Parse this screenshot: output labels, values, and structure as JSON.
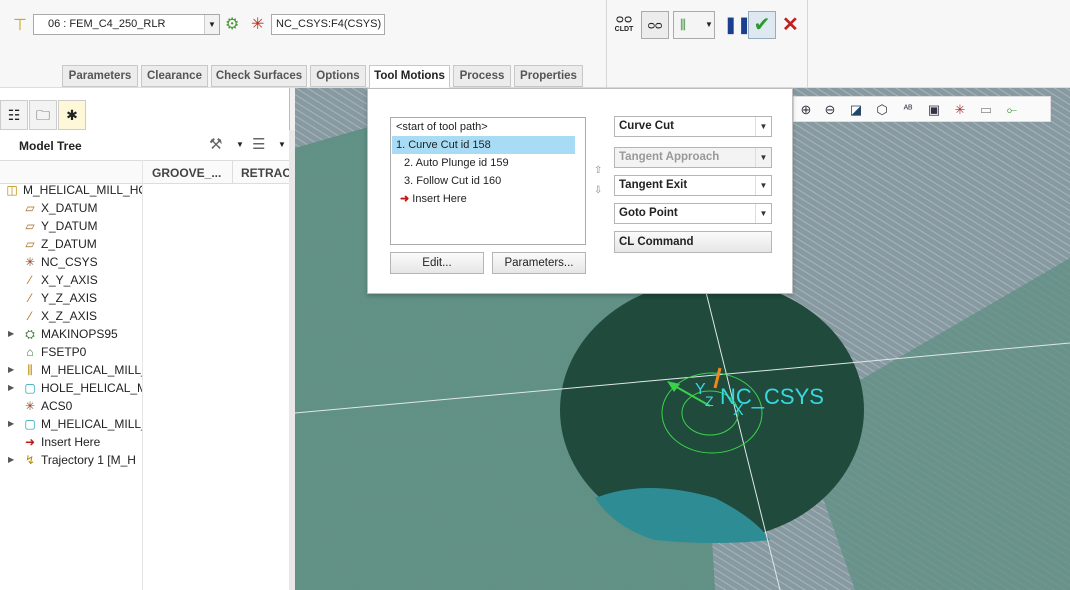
{
  "toolbar": {
    "tool_value": "06 : FEM_C4_250_RLR",
    "coord_value": "NC_CSYS:F4(CSYS) I",
    "cldt_label": "CLDT",
    "pause_icon": "pause-icon",
    "apply_icon": "checkmark-icon",
    "cancel_icon": "close-icon"
  },
  "tabs": [
    "Parameters",
    "Clearance",
    "Check Surfaces",
    "Options",
    "Tool Motions",
    "Process",
    "Properties"
  ],
  "active_tab": "Tool Motions",
  "model_tree": {
    "title": "Model Tree",
    "columns": [
      "GROOVE_...",
      "RETRAC"
    ],
    "items": [
      {
        "label": "M_HELICAL_MILL_HO",
        "icon": "assembly-icon",
        "expand": false
      },
      {
        "label": "X_DATUM",
        "icon": "datum-plane-icon",
        "expand": false
      },
      {
        "label": "Y_DATUM",
        "icon": "datum-plane-icon",
        "expand": false
      },
      {
        "label": "Z_DATUM",
        "icon": "datum-plane-icon",
        "expand": false
      },
      {
        "label": "NC_CSYS",
        "icon": "csys-icon",
        "expand": false
      },
      {
        "label": "X_Y_AXIS",
        "icon": "axis-icon",
        "expand": false
      },
      {
        "label": "Y_Z_AXIS",
        "icon": "axis-icon",
        "expand": false
      },
      {
        "label": "X_Z_AXIS",
        "icon": "axis-icon",
        "expand": false
      },
      {
        "label": "MAKINOPS95",
        "icon": "machine-icon",
        "expand": true
      },
      {
        "label": "FSETP0",
        "icon": "fixture-icon",
        "expand": false
      },
      {
        "label": "M_HELICAL_MILL_",
        "icon": "workpiece-icon",
        "expand": true
      },
      {
        "label": "HOLE_HELICAL_M",
        "icon": "part-icon",
        "expand": true
      },
      {
        "label": "ACS0",
        "icon": "csys-icon",
        "expand": false
      },
      {
        "label": "M_HELICAL_MILL_",
        "icon": "part-icon",
        "expand": true
      },
      {
        "label": "Insert Here",
        "icon": "insert-arrow-icon",
        "expand": false
      },
      {
        "label": "Trajectory 1 [M_H",
        "icon": "trajectory-icon",
        "expand": true
      }
    ]
  },
  "tool_motions": {
    "list": [
      "<start of tool path>",
      "1. Curve Cut id 158",
      "2. Auto Plunge id 159",
      "3. Follow Cut id 160",
      "Insert Here"
    ],
    "selected_index": 1,
    "edit_label": "Edit...",
    "parameters_label": "Parameters...",
    "curve_cut": "Curve Cut",
    "tangent_approach": "Tangent Approach",
    "tangent_exit": "Tangent Exit",
    "goto_point": "Goto Point",
    "cl_command": "CL Command"
  },
  "viewport": {
    "csys_label": "NC_CSYS",
    "axis_y": "Y",
    "axis_z": "Z",
    "axis_x": "X",
    "colors": {
      "background": "#8a9aa0",
      "surface": "#5f8f84",
      "disk": "#1f4a3c",
      "csys": "#39d7e0"
    }
  }
}
